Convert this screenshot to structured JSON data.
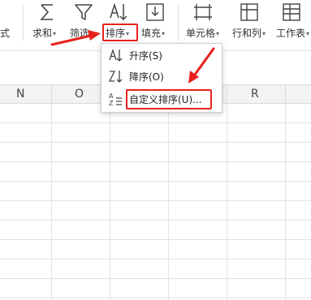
{
  "ribbon": {
    "items": [
      {
        "label": "式"
      },
      {
        "label": "求和"
      },
      {
        "label": "筛选"
      },
      {
        "label": "排序"
      },
      {
        "label": "填充"
      },
      {
        "label": "单元格"
      },
      {
        "label": "行和列"
      },
      {
        "label": "工作表"
      }
    ]
  },
  "columns": [
    "N",
    "O",
    "P",
    "Q",
    "R"
  ],
  "sort_menu": {
    "items": [
      {
        "label": "升序(S)",
        "icon": "sort-ascending-icon"
      },
      {
        "label": "降序(O)",
        "icon": "sort-descending-icon"
      },
      {
        "label": "自定义排序(U)...",
        "icon": "custom-sort-icon"
      }
    ]
  },
  "colors": {
    "highlight": "#e8211d",
    "accent": "#1a73c8"
  }
}
